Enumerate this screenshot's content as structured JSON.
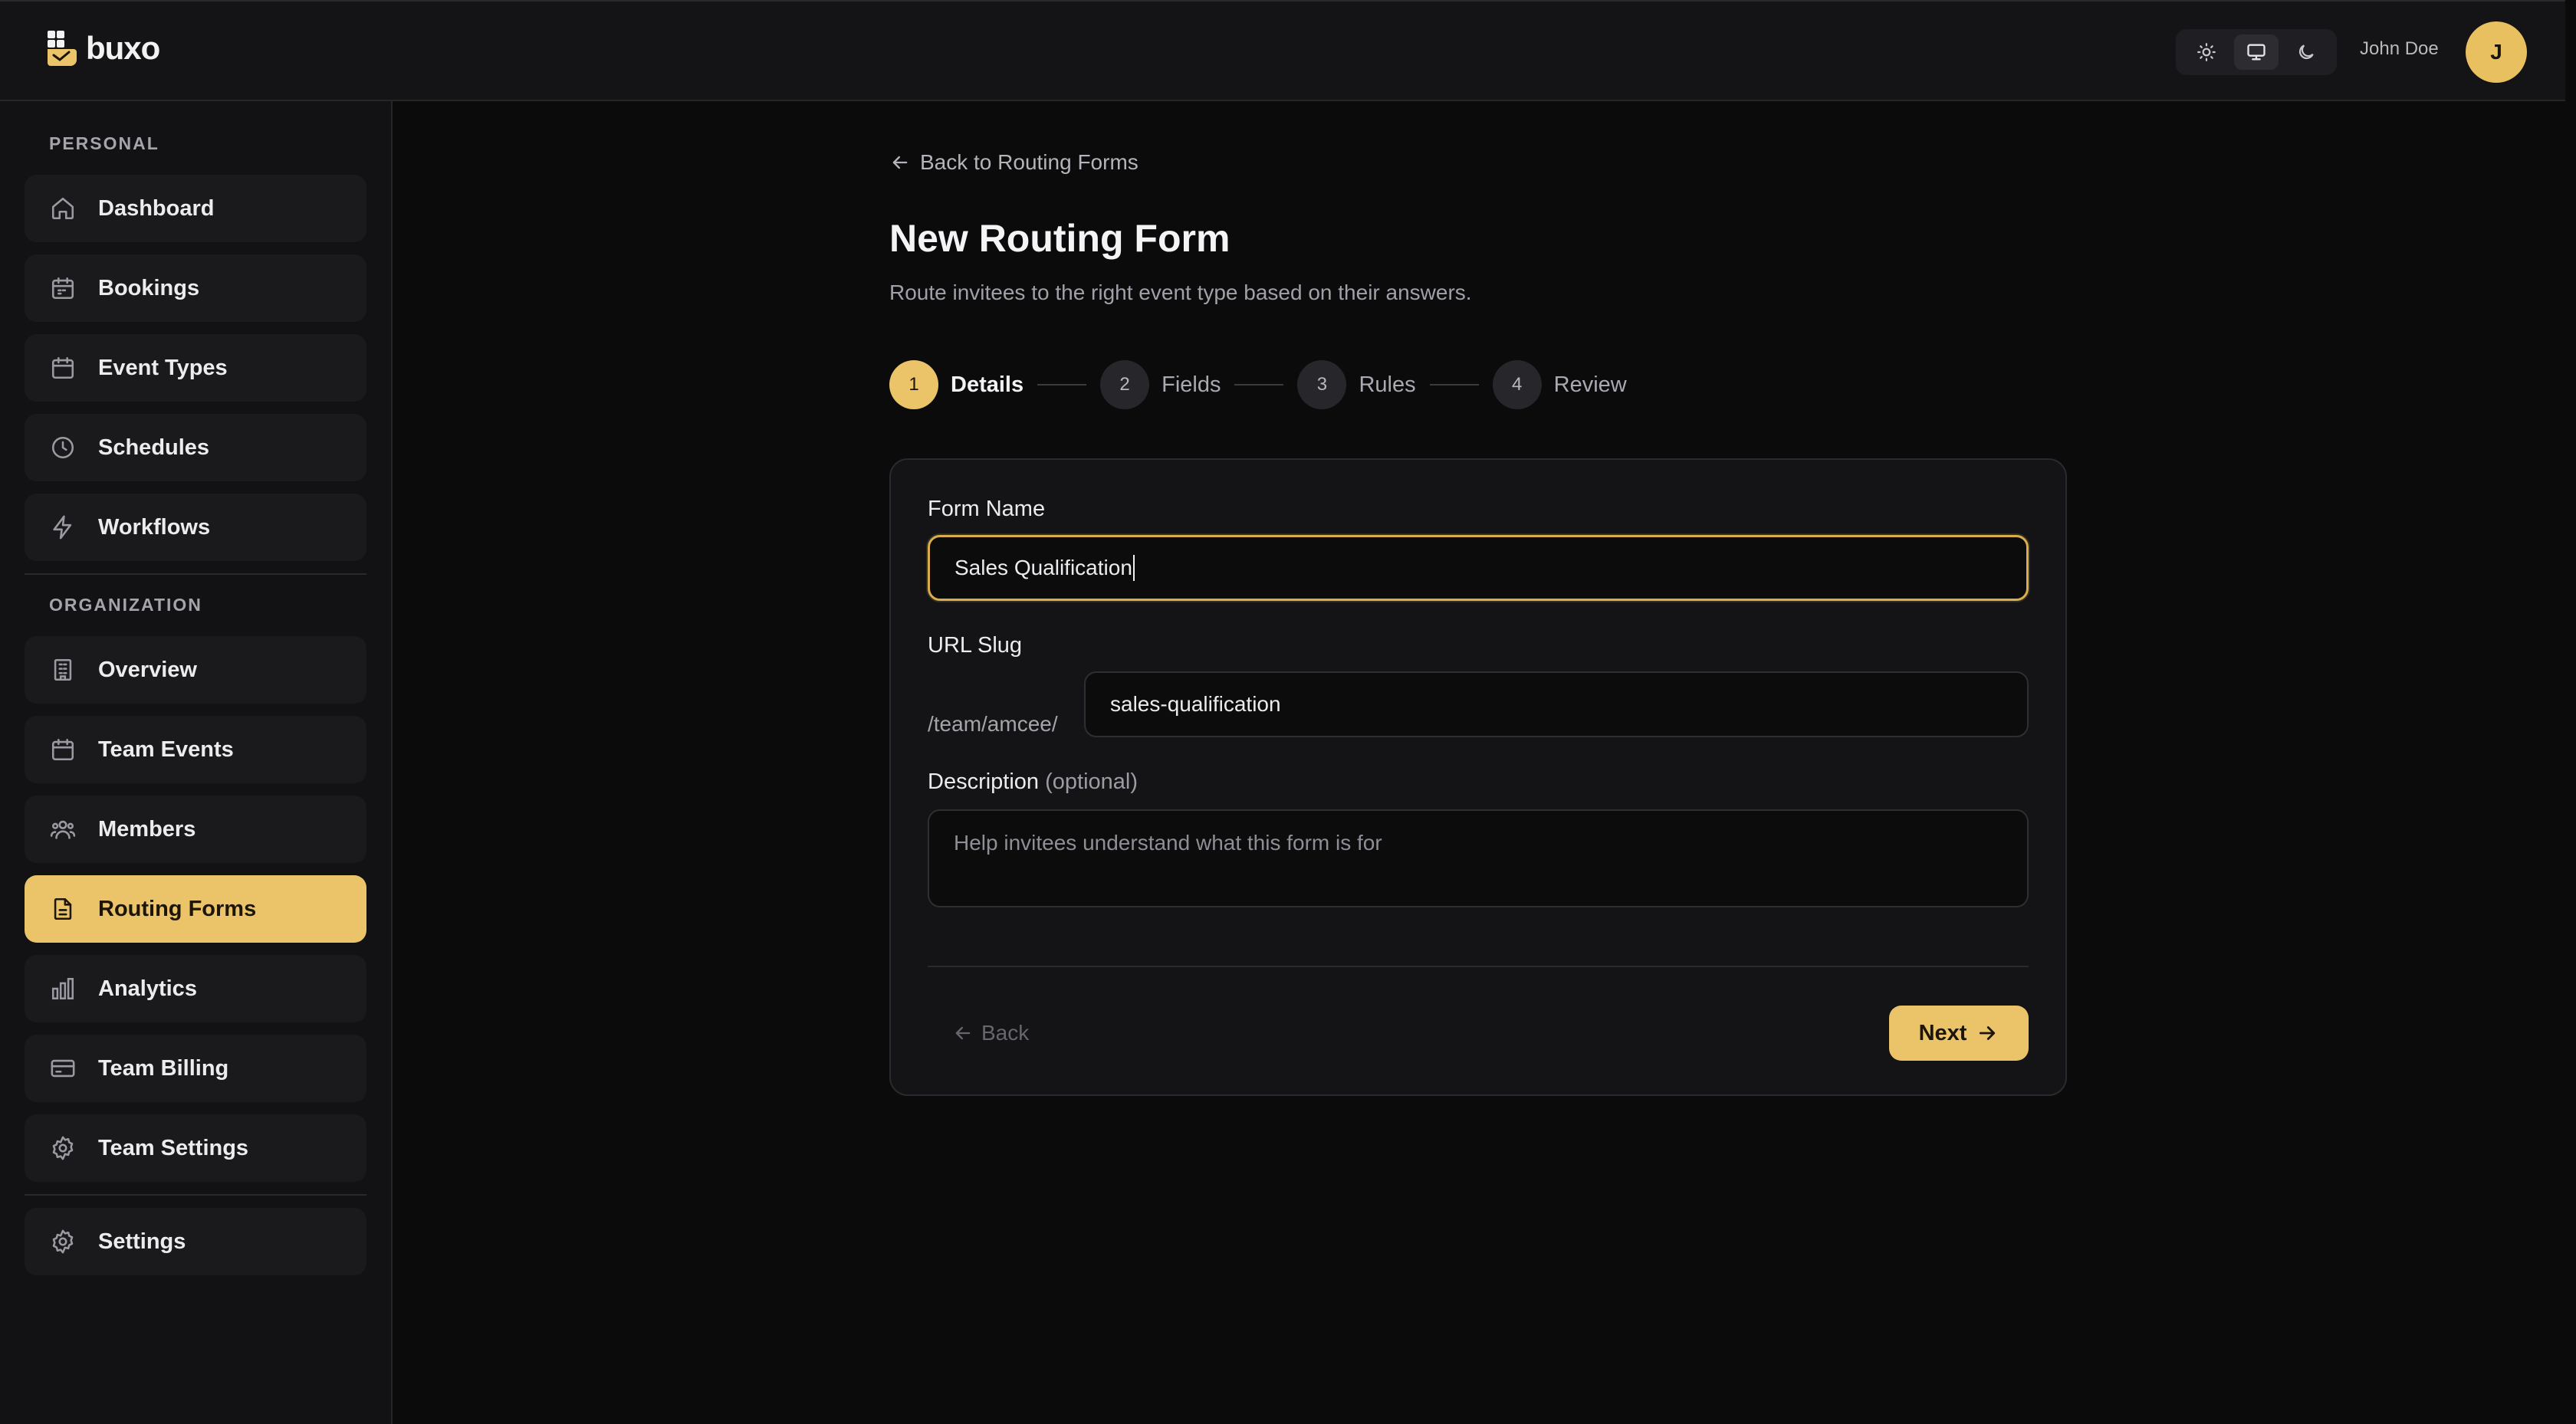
{
  "brand": {
    "name": "buxo",
    "accent": "#ebc469"
  },
  "header": {
    "theme_options": [
      {
        "icon": "sun-icon",
        "name": "light"
      },
      {
        "icon": "monitor-icon",
        "name": "system"
      },
      {
        "icon": "moon-icon",
        "name": "dark"
      }
    ],
    "user_name": "John Doe",
    "avatar_initial": "J"
  },
  "sidebar": {
    "personal_title": "PERSONAL",
    "personal_items": [
      {
        "label": "Dashboard",
        "icon": "home-icon"
      },
      {
        "label": "Bookings",
        "icon": "calendar-icon"
      },
      {
        "label": "Event Types",
        "icon": "calendar-icon"
      },
      {
        "label": "Schedules",
        "icon": "clock-icon"
      },
      {
        "label": "Workflows",
        "icon": "lightning-icon"
      }
    ],
    "organization_title": "ORGANIZATION",
    "organization_items": [
      {
        "label": "Overview",
        "icon": "building-icon"
      },
      {
        "label": "Team Events",
        "icon": "calendar-icon"
      },
      {
        "label": "Members",
        "icon": "users-icon"
      },
      {
        "label": "Routing Forms",
        "icon": "file-text-icon",
        "active": true
      },
      {
        "label": "Analytics",
        "icon": "bar-chart-icon"
      },
      {
        "label": "Team Billing",
        "icon": "credit-card-icon"
      },
      {
        "label": "Team Settings",
        "icon": "gear-icon"
      }
    ],
    "footer_items": [
      {
        "label": "Settings",
        "icon": "gear-icon"
      }
    ]
  },
  "main": {
    "back_link": "Back to Routing Forms",
    "title": "New Routing Form",
    "subtitle": "Route invitees to the right event type based on their answers.",
    "steps": [
      {
        "number": "1",
        "label": "Details",
        "active": true
      },
      {
        "number": "2",
        "label": "Fields"
      },
      {
        "number": "3",
        "label": "Rules"
      },
      {
        "number": "4",
        "label": "Review"
      }
    ],
    "form": {
      "name_label": "Form Name",
      "name_value": "Sales Qualification",
      "slug_label": "URL Slug",
      "slug_prefix": "/team/amcee/",
      "slug_value": "sales-qualification",
      "description_label": "Description",
      "description_optional": "(optional)",
      "description_placeholder": "Help invitees understand what this form is for",
      "back_button": "Back",
      "next_button": "Next"
    }
  }
}
